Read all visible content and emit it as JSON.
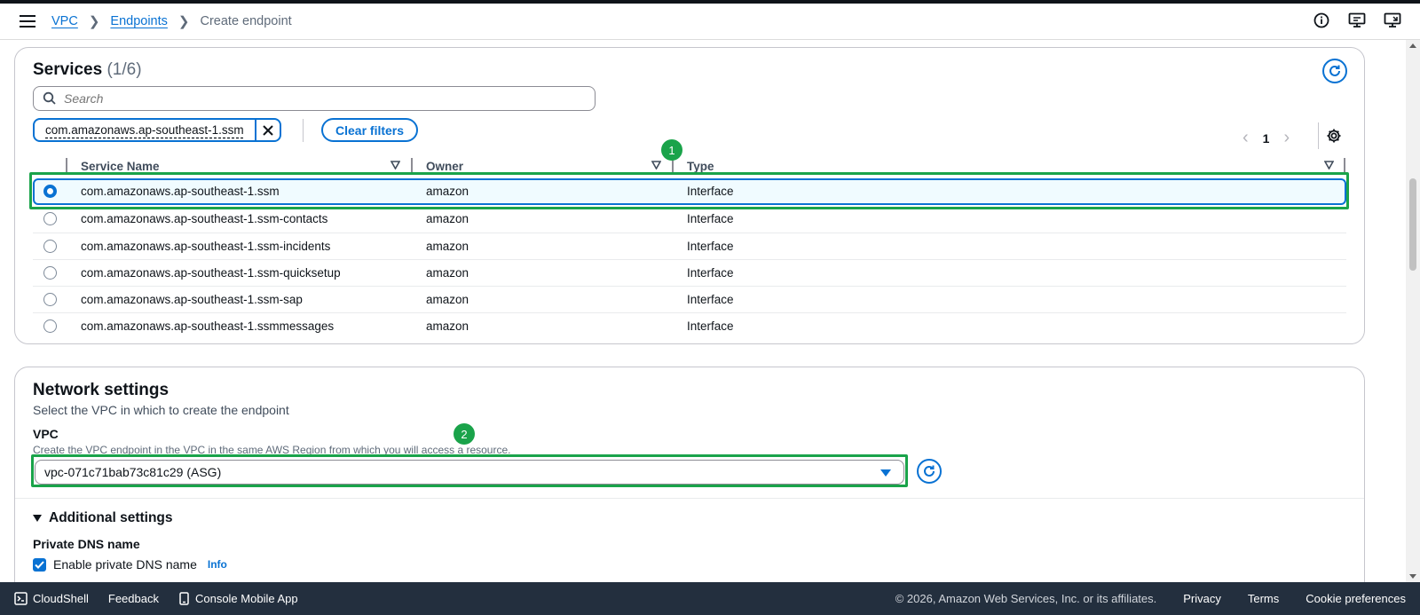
{
  "header": {
    "breadcrumbs": [
      {
        "label": "VPC"
      },
      {
        "label": "Endpoints"
      },
      {
        "label": "Create endpoint"
      }
    ]
  },
  "services": {
    "title": "Services",
    "count": "(1/6)",
    "search_placeholder": "Search",
    "filter_token": "com.amazonaws.ap-southeast-1.ssm",
    "clear_filters_label": "Clear filters",
    "page": "1",
    "columns": [
      "Service Name",
      "Owner",
      "Type"
    ],
    "rows": [
      {
        "name": "com.amazonaws.ap-southeast-1.ssm",
        "owner": "amazon",
        "type": "Interface",
        "selected": true
      },
      {
        "name": "com.amazonaws.ap-southeast-1.ssm-contacts",
        "owner": "amazon",
        "type": "Interface",
        "selected": false
      },
      {
        "name": "com.amazonaws.ap-southeast-1.ssm-incidents",
        "owner": "amazon",
        "type": "Interface",
        "selected": false
      },
      {
        "name": "com.amazonaws.ap-southeast-1.ssm-quicksetup",
        "owner": "amazon",
        "type": "Interface",
        "selected": false
      },
      {
        "name": "com.amazonaws.ap-southeast-1.ssm-sap",
        "owner": "amazon",
        "type": "Interface",
        "selected": false
      },
      {
        "name": "com.amazonaws.ap-southeast-1.ssmmessages",
        "owner": "amazon",
        "type": "Interface",
        "selected": false
      }
    ]
  },
  "callouts": [
    "1",
    "2"
  ],
  "network": {
    "title": "Network settings",
    "description": "Select the VPC in which to create the endpoint",
    "vpc_label": "VPC",
    "vpc_description": "Create the VPC endpoint in the VPC in the same AWS Region from which you will access a resource.",
    "vpc_value": "vpc-071c71bab73c81c29 (ASG)",
    "additional_settings": "Additional settings",
    "private_dns_label": "Private DNS name",
    "enable_private_dns": "Enable private DNS name",
    "enable_private_dns_checked": true,
    "info_label": "Info"
  },
  "footer": {
    "cloudshell": "CloudShell",
    "feedback": "Feedback",
    "console_mobile": "Console Mobile App",
    "copyright": "© 2026, Amazon Web Services, Inc. or its affiliates.",
    "privacy": "Privacy",
    "terms": "Terms",
    "cookies": "Cookie preferences"
  },
  "colors": {
    "accent": "#0972d3",
    "callout": "#1aa34a",
    "footer_bg": "#232f3e"
  }
}
